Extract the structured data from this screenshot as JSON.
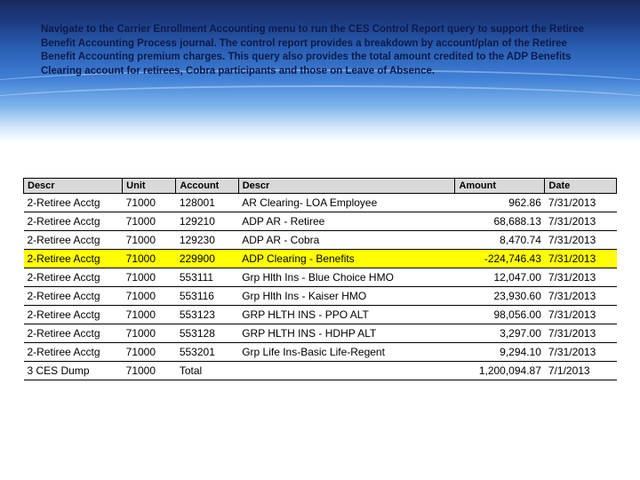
{
  "instruction": "Navigate to the Carrier Enrollment Accounting menu to run the CES Control Report query to support the Retiree Benefit Accounting Process journal.  The control report provides a breakdown by account/plan of the Retiree Benefit Accounting premium charges.  This query also provides the total amount credited to the ADP Benefits Clearing account for retirees, Cobra participants and those on Leave of Absence.",
  "headers": {
    "descr1": "Descr",
    "unit": "Unit",
    "account": "Account",
    "descr2": "Descr",
    "amount": "Amount",
    "date": "Date"
  },
  "rows": [
    {
      "descr1": "2-Retiree Acctg",
      "unit": "71000",
      "account": "128001",
      "descr2": "AR Clearing- LOA Employee",
      "amount": "962.86",
      "date": "7/31/2013",
      "hl": false
    },
    {
      "descr1": "2-Retiree Acctg",
      "unit": "71000",
      "account": "129210",
      "descr2": "ADP AR - Retiree",
      "amount": "68,688.13",
      "date": "7/31/2013",
      "hl": false
    },
    {
      "descr1": "2-Retiree Acctg",
      "unit": "71000",
      "account": "129230",
      "descr2": "ADP AR - Cobra",
      "amount": "8,470.74",
      "date": "7/31/2013",
      "hl": false
    },
    {
      "descr1": "2-Retiree Acctg",
      "unit": "71000",
      "account": "229900",
      "descr2": "ADP Clearing - Benefits",
      "amount": "-224,746.43",
      "date": "7/31/2013",
      "hl": true
    },
    {
      "descr1": "2-Retiree Acctg",
      "unit": "71000",
      "account": "553111",
      "descr2": "Grp Hlth Ins - Blue Choice HMO",
      "amount": "12,047.00",
      "date": "7/31/2013",
      "hl": false
    },
    {
      "descr1": "2-Retiree Acctg",
      "unit": "71000",
      "account": "553116",
      "descr2": "Grp Hlth Ins - Kaiser HMO",
      "amount": "23,930.60",
      "date": "7/31/2013",
      "hl": false
    },
    {
      "descr1": "2-Retiree Acctg",
      "unit": "71000",
      "account": "553123",
      "descr2": "GRP HLTH INS - PPO ALT",
      "amount": "98,056.00",
      "date": "7/31/2013",
      "hl": false
    },
    {
      "descr1": "2-Retiree Acctg",
      "unit": "71000",
      "account": "553128",
      "descr2": "GRP HLTH INS - HDHP ALT",
      "amount": "3,297.00",
      "date": "7/31/2013",
      "hl": false
    },
    {
      "descr1": "2-Retiree Acctg",
      "unit": "71000",
      "account": "553201",
      "descr2": "Grp Life Ins-Basic Life-Regent",
      "amount": "9,294.10",
      "date": "7/31/2013",
      "hl": false
    },
    {
      "descr1": "3 CES Dump",
      "unit": "71000",
      "account": "Total",
      "descr2": "",
      "amount": "1,200,094.87",
      "date": "7/1/2013",
      "hl": false
    }
  ]
}
